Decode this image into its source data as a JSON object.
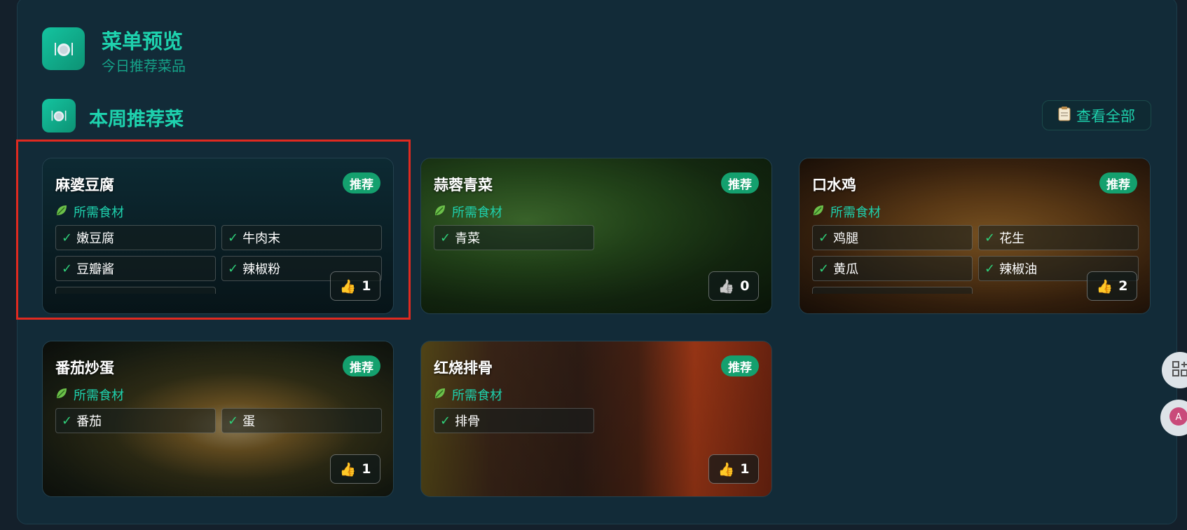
{
  "header": {
    "title": "菜单预览",
    "subtitle": "今日推荐菜品",
    "icon": "plate-icon"
  },
  "section": {
    "title": "本周推荐菜",
    "view_all_label": "查看全部",
    "view_all_icon": "clipboard-icon"
  },
  "ingredients_heading": "所需食材",
  "dishes": [
    {
      "name": "麻婆豆腐",
      "badge": "推荐",
      "ingredients": [
        "嫩豆腐",
        "牛肉末",
        "豆瓣酱",
        "辣椒粉"
      ],
      "likes": "1",
      "like_icon": "thumbs-up-icon"
    },
    {
      "name": "蒜蓉青菜",
      "badge": "推荐",
      "ingredients": [
        "青菜"
      ],
      "likes": "0",
      "like_icon": "thumbs-up-gray-icon"
    },
    {
      "name": "口水鸡",
      "badge": "推荐",
      "ingredients": [
        "鸡腿",
        "花生",
        "黄瓜",
        "辣椒油"
      ],
      "likes": "2",
      "like_icon": "thumbs-up-icon"
    },
    {
      "name": "番茄炒蛋",
      "badge": "推荐",
      "ingredients": [
        "番茄",
        "蛋"
      ],
      "likes": "1",
      "like_icon": "thumbs-up-icon"
    },
    {
      "name": "红烧排骨",
      "badge": "推荐",
      "ingredients": [
        "排骨"
      ],
      "likes": "1",
      "like_icon": "thumbs-up-icon"
    }
  ],
  "colors": {
    "accent": "#1ed1ad",
    "badge": "#14a06e",
    "check": "#2fd07a",
    "highlight": "#e02a20"
  }
}
